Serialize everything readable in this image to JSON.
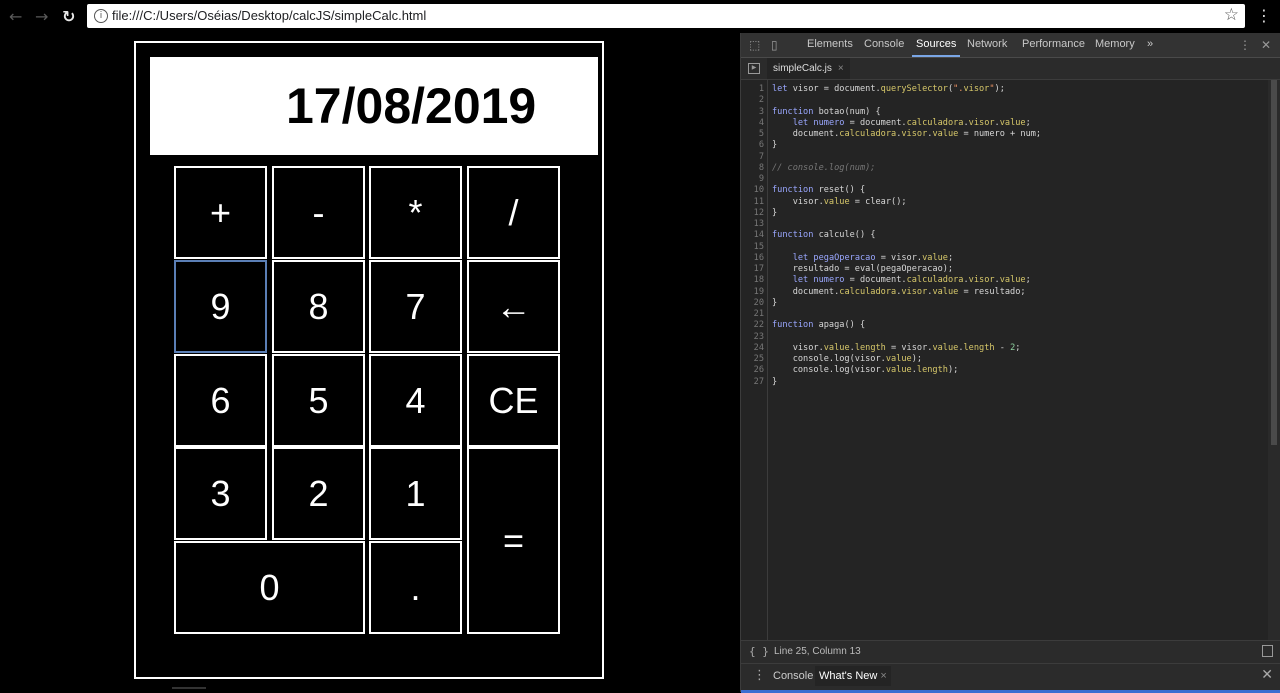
{
  "browser": {
    "back_icon": "←",
    "forward_icon": "→",
    "reload_icon": "C",
    "url": "file:///C:/Users/Oséias/Desktop/calcJS/simpleCalc.html",
    "star_icon": "☆",
    "menu_icon": "⋮"
  },
  "calculator": {
    "display_value": "17/08/2019",
    "keys": [
      "+",
      "-",
      "*",
      "/",
      "9",
      "8",
      "7",
      "←",
      "6",
      "5",
      "4",
      "CE",
      "3",
      "2",
      "1",
      "=",
      "0",
      "."
    ]
  },
  "devtools": {
    "tabs": [
      "Elements",
      "Console",
      "Sources",
      "Network",
      "Performance",
      "Memory"
    ],
    "active_tab": "Sources",
    "more_tabs_icon": "»",
    "file_tab": "simpleCalc.js",
    "status_text": "Line 25, Column 13",
    "drawer_tabs": [
      "Console",
      "What's New"
    ],
    "code_lines": [
      "let visor = document.querySelector(\".visor\");",
      "",
      "function botao(num) {",
      "    let numero = document.calculadora.visor.value;",
      "    document.calculadora.visor.value = numero + num;",
      "}",
      "",
      "// console.log(num);",
      "",
      "function reset() {",
      "    visor.value = clear();",
      "}",
      "",
      "function calcule() {",
      "",
      "    let pegaOperacao = visor.value;",
      "    resultado = eval(pegaOperacao);",
      "    let numero = document.calculadora.visor.value;",
      "    document.calculadora.visor.value = resultado;",
      "}",
      "",
      "function apaga() {",
      "",
      "    visor.value.length = visor.value.length - 2;",
      "    console.log(visor.value);",
      "    console.log(visor.value.length);",
      "}"
    ]
  }
}
